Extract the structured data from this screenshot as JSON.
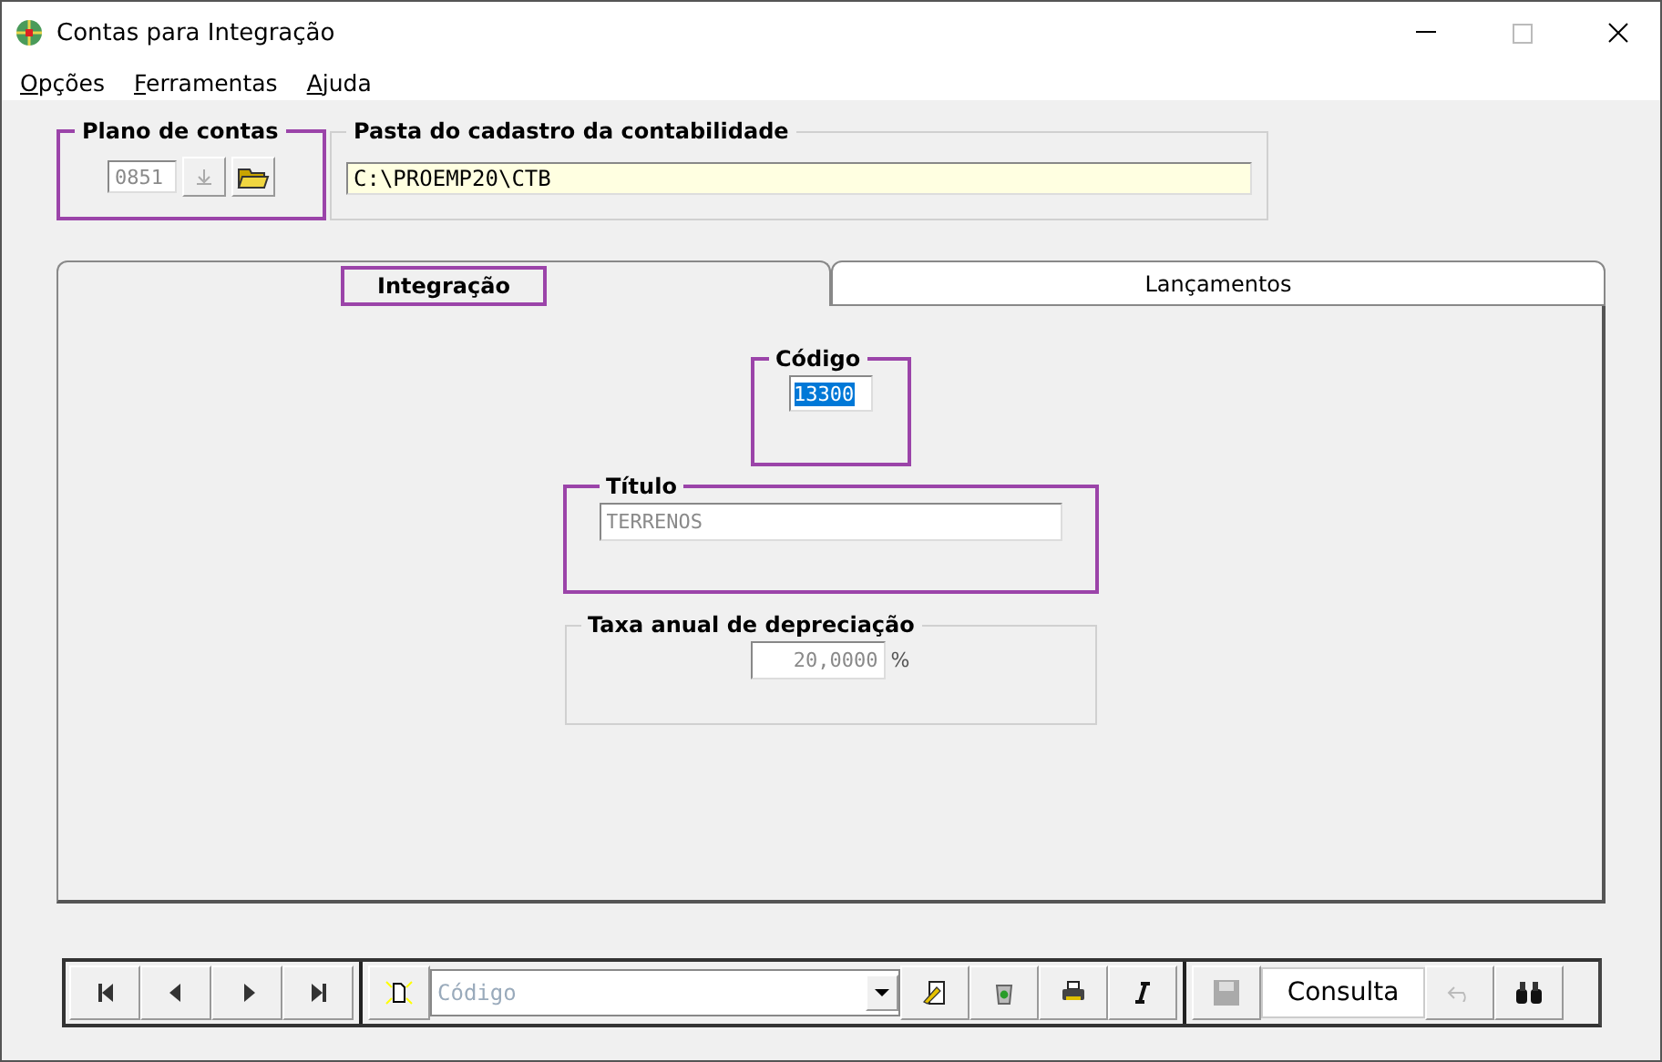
{
  "window": {
    "title": "Contas para Integração"
  },
  "menu": [
    {
      "label": "Opções"
    },
    {
      "label": "Ferramentas"
    },
    {
      "label": "Ajuda"
    }
  ],
  "plano": {
    "label": "Plano de contas",
    "value": "0851",
    "disabled": true,
    "highlighted": true
  },
  "pasta": {
    "label": "Pasta do cadastro da contabilidade",
    "value": "C:\\PROEMP20\\CTB"
  },
  "tabs": [
    {
      "label": "Integração",
      "selected": true,
      "highlighted": true
    },
    {
      "label": "Lançamentos",
      "selected": false,
      "highlighted": false
    }
  ],
  "codigo": {
    "label": "Código",
    "value": "13300",
    "text_selected": true,
    "highlighted": true
  },
  "titulo": {
    "label": "Título",
    "value": "TERRENOS",
    "disabled": true,
    "highlighted": true
  },
  "taxa": {
    "label": "Taxa anual de depreciação",
    "value": "20,0000",
    "unit": "%",
    "disabled": true,
    "highlighted": false
  },
  "toolbar": {
    "nav": [
      {
        "kind": "first",
        "disabled": false
      },
      {
        "kind": "prev",
        "disabled": false
      },
      {
        "kind": "next",
        "disabled": false
      },
      {
        "kind": "last",
        "disabled": false
      }
    ],
    "search": {
      "placeholder": "Código"
    },
    "actions": [
      {
        "kind": "edit",
        "disabled": false
      },
      {
        "kind": "recycle",
        "disabled": false
      },
      {
        "kind": "print",
        "disabled": false
      },
      {
        "kind": "italic",
        "disabled": false
      }
    ],
    "save": {
      "disabled": true
    },
    "mode": "Consulta",
    "undo": {
      "disabled": true
    }
  }
}
